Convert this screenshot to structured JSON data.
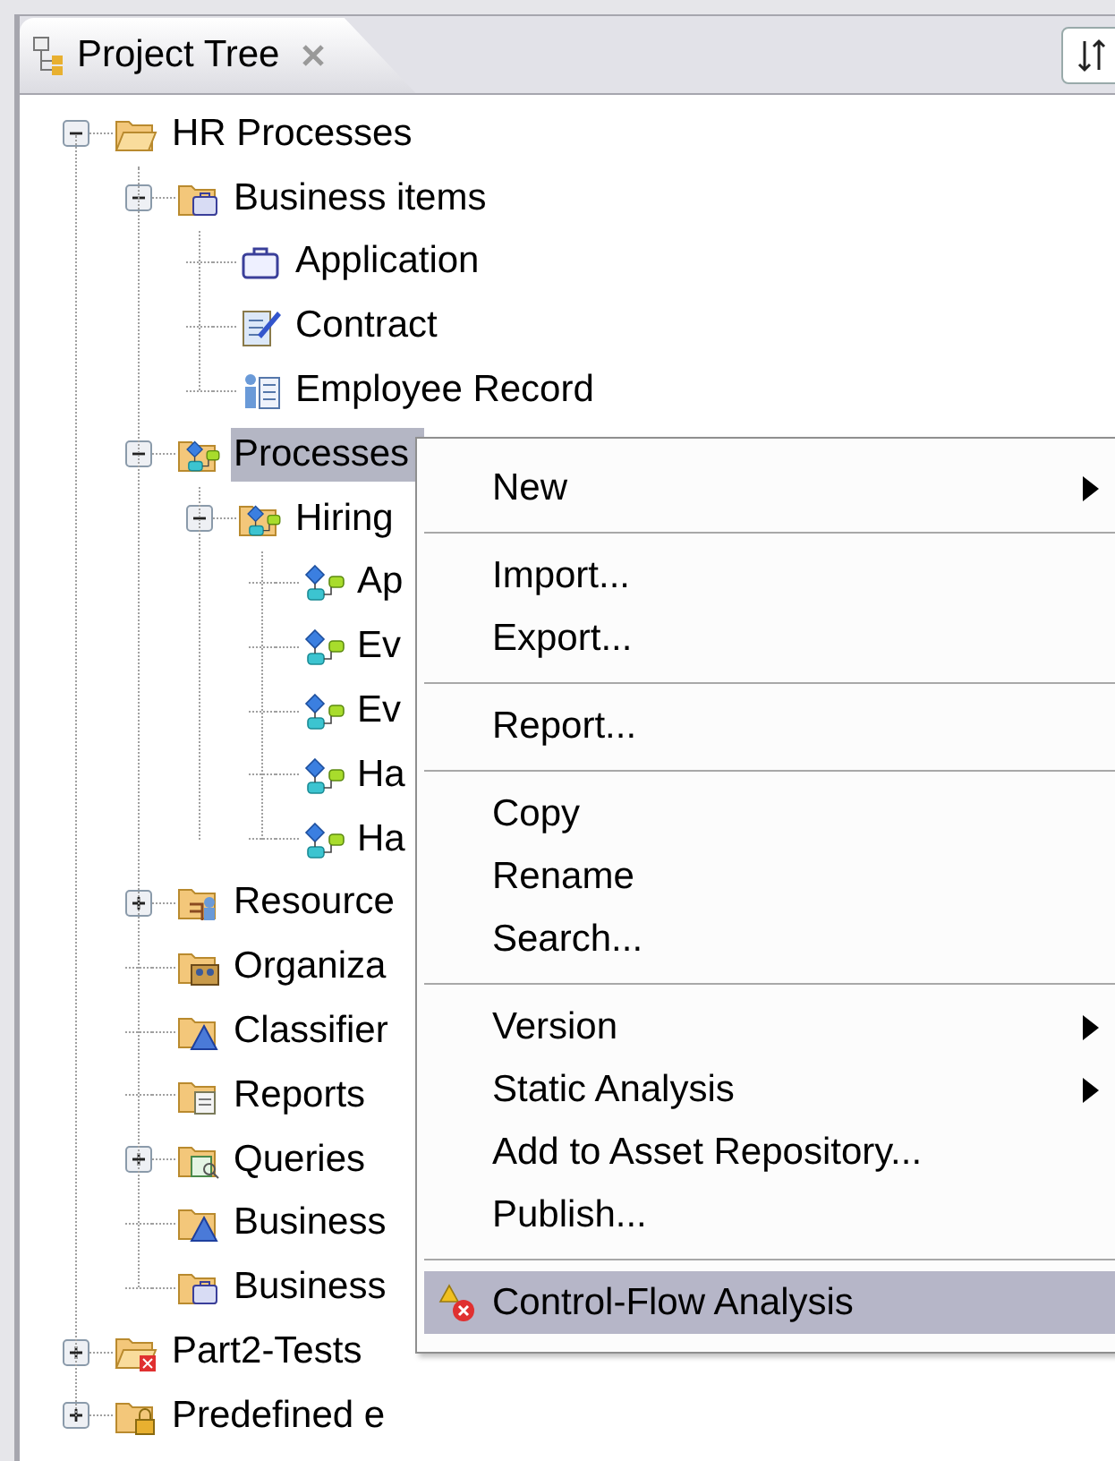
{
  "panel": {
    "title": "Project Tree"
  },
  "tree": [
    {
      "label": "HR Processes",
      "kind": "open-folder",
      "expanded": true,
      "selected": false,
      "children": [
        {
          "label": "Business items",
          "kind": "items-folder",
          "expanded": true,
          "selected": false,
          "children": [
            {
              "label": "Application",
              "kind": "briefcase",
              "selected": false
            },
            {
              "label": "Contract",
              "kind": "document",
              "selected": false
            },
            {
              "label": "Employee Record",
              "kind": "person-record",
              "selected": false
            }
          ]
        },
        {
          "label": "Processes",
          "kind": "process-folder",
          "expanded": true,
          "selected": true,
          "children": [
            {
              "label": "Hiring",
              "kind": "process-folder",
              "expanded": true,
              "selected": false,
              "children": [
                {
                  "label": "Ap",
                  "kind": "process",
                  "selected": false
                },
                {
                  "label": "Ev",
                  "kind": "process",
                  "selected": false
                },
                {
                  "label": "Ev",
                  "kind": "process",
                  "selected": false
                },
                {
                  "label": "Ha",
                  "kind": "process",
                  "selected": false
                },
                {
                  "label": "Ha",
                  "kind": "process",
                  "selected": false
                }
              ]
            }
          ]
        },
        {
          "label": "Resource",
          "kind": "resources-folder",
          "expanded": false,
          "selected": false
        },
        {
          "label": "Organiza",
          "kind": "org-folder",
          "selected": false
        },
        {
          "label": "Classifier",
          "kind": "classifier-folder",
          "selected": false
        },
        {
          "label": "Reports",
          "kind": "report-folder",
          "selected": false
        },
        {
          "label": "Queries",
          "kind": "query-folder",
          "expanded": false,
          "selected": false
        },
        {
          "label": "Business",
          "kind": "classifier-folder",
          "selected": false
        },
        {
          "label": "Business",
          "kind": "items-folder",
          "selected": false
        }
      ]
    },
    {
      "label": "Part2-Tests",
      "kind": "error-folder",
      "expanded": false,
      "selected": false
    },
    {
      "label": "Predefined e",
      "kind": "locked-folder",
      "expanded": false,
      "selected": false
    }
  ],
  "context_menu": [
    {
      "kind": "submenu",
      "label": "New",
      "selected": false
    },
    {
      "kind": "separator"
    },
    {
      "kind": "item",
      "label": "Import...",
      "selected": false
    },
    {
      "kind": "item",
      "label": "Export...",
      "selected": false
    },
    {
      "kind": "separator"
    },
    {
      "kind": "item",
      "label": "Report...",
      "selected": false
    },
    {
      "kind": "separator"
    },
    {
      "kind": "item",
      "label": "Copy",
      "selected": false
    },
    {
      "kind": "item",
      "label": "Rename",
      "selected": false
    },
    {
      "kind": "item",
      "label": "Search...",
      "selected": false
    },
    {
      "kind": "separator"
    },
    {
      "kind": "submenu",
      "label": "Version",
      "selected": false
    },
    {
      "kind": "submenu",
      "label": "Static Analysis",
      "selected": false
    },
    {
      "kind": "item",
      "label": "Add to Asset Repository...",
      "selected": false
    },
    {
      "kind": "item",
      "label": "Publish...",
      "selected": false
    },
    {
      "kind": "separator"
    },
    {
      "kind": "analysis",
      "label": "Control-Flow Analysis",
      "selected": true
    }
  ]
}
